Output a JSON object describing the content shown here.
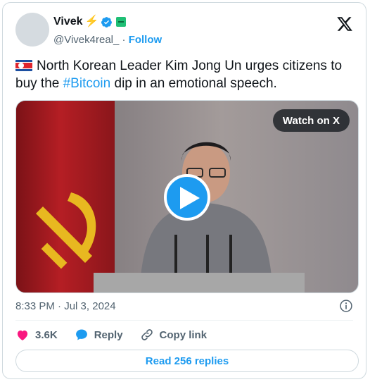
{
  "author": {
    "name": "Vivek",
    "handle": "@Vivek4real_",
    "separator": "·",
    "follow_label": "Follow"
  },
  "tweet": {
    "text_before": "North Korean Leader Kim Jong Un urges citizens to buy the ",
    "hashtag": "#Bitcoin",
    "text_after": " dip in an emotional speech."
  },
  "media": {
    "watch_label": "Watch on X"
  },
  "meta": {
    "time": "8:33 PM",
    "separator": "·",
    "date": "Jul 3, 2024"
  },
  "actions": {
    "likes": "3.6K",
    "reply_label": "Reply",
    "copy_label": "Copy link"
  },
  "read_replies_label": "Read 256 replies",
  "colors": {
    "accent": "#1d9bf0",
    "like": "#f91880",
    "bolt": "#f5a623"
  },
  "icons": [
    "x-logo-icon",
    "verified-badge-icon",
    "lightning-icon",
    "play-icon",
    "info-icon",
    "heart-icon",
    "reply-icon",
    "link-icon",
    "north-korea-flag-icon"
  ]
}
